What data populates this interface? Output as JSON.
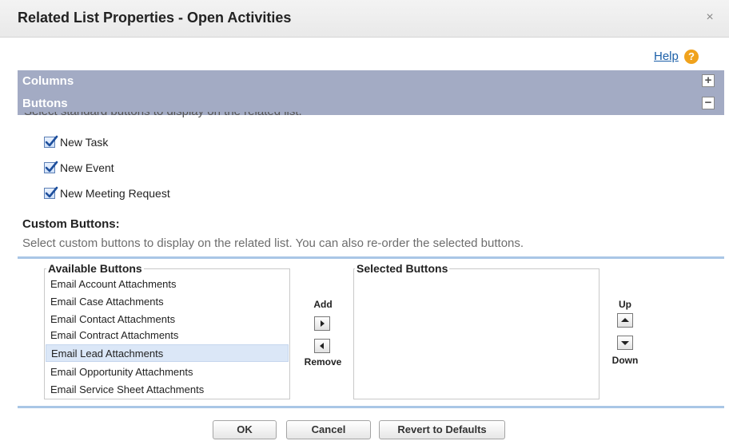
{
  "dialog": {
    "title": "Related List Properties - Open Activities",
    "close_glyph": "×",
    "help_label": "Help",
    "help_glyph": "?"
  },
  "sections": {
    "columns_label": "Columns",
    "columns_toggle": "+",
    "buttons_label": "Buttons",
    "buttons_toggle": "−"
  },
  "standard_buttons": {
    "description": "Select standard buttons to display on the related list.",
    "items": [
      {
        "label": "New Task",
        "checked": true
      },
      {
        "label": "New Event",
        "checked": true
      },
      {
        "label": "New Meeting Request",
        "checked": true
      }
    ]
  },
  "custom_buttons": {
    "heading": "Custom Buttons:",
    "description": "Select custom buttons to display on the related list. You can also re-order the selected buttons.",
    "available_label": "Available Buttons",
    "selected_label": "Selected Buttons",
    "available_items": [
      "Email Account Attachments",
      "Email Case Attachments",
      "Email Contact Attachments",
      "Email Contract Attachments",
      "Email Lead Attachments",
      "Email Opportunity Attachments",
      "Email Service Sheet Attachments"
    ],
    "highlighted_item": "Email Lead Attachments",
    "selected_items": [],
    "add_label": "Add",
    "remove_label": "Remove",
    "up_label": "Up",
    "down_label": "Down"
  },
  "footer": {
    "ok_label": "OK",
    "cancel_label": "Cancel",
    "revert_label": "Revert to Defaults"
  },
  "colors": {
    "section_bar": "#a3abc4",
    "link": "#1b5fa8",
    "help_icon": "#f0a21c",
    "divider": "#a9c6e6",
    "highlight_row": "#dbe7f7"
  }
}
